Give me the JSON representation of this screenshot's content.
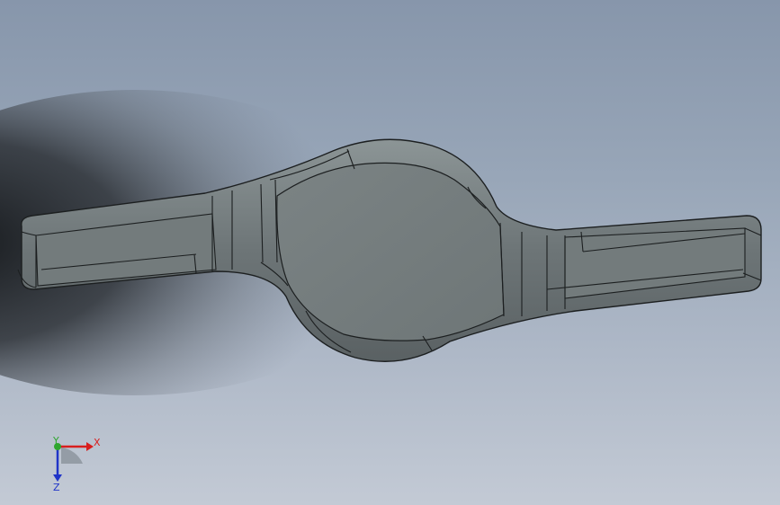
{
  "triad": {
    "x_label": "X",
    "y_label": "Y",
    "z_label": "Z"
  },
  "colors": {
    "x_axis": "#d81e1e",
    "y_axis": "#2fa62f",
    "z_axis": "#1f34c8",
    "part_fill": "#737b7c",
    "part_edge": "#1c1f20",
    "background_top": "#8796ab",
    "background_bottom": "#c3cad5"
  }
}
